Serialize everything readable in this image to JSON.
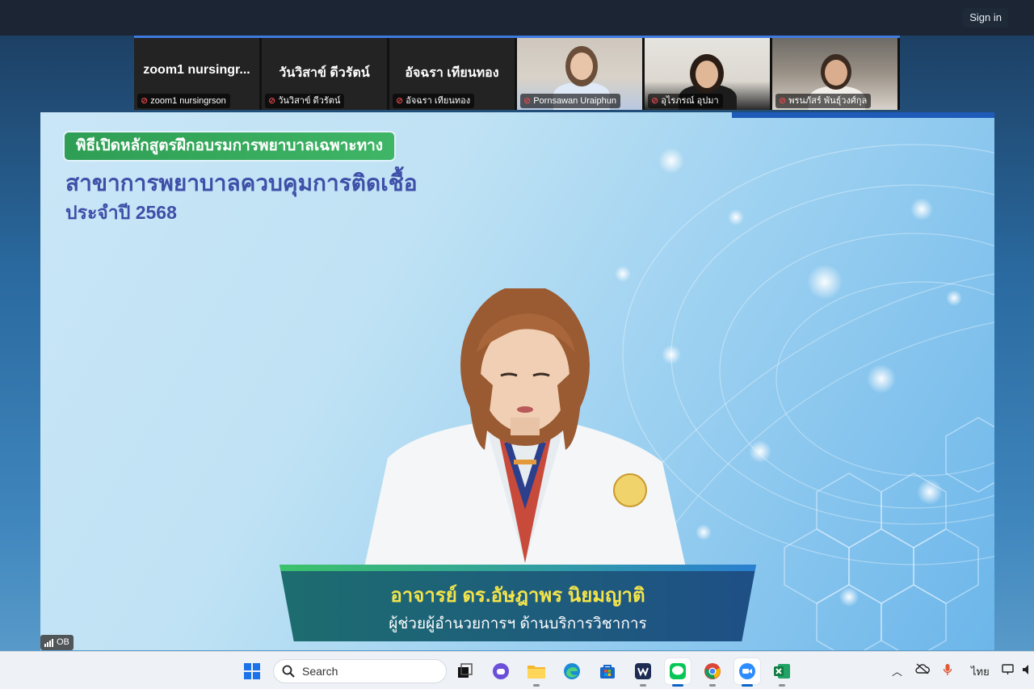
{
  "topbar": {
    "signin_label": "Sign in"
  },
  "participants": [
    {
      "display_name": "zoom1  nursingr...",
      "label": "zoom1 nursingrson",
      "video": false,
      "muted": true
    },
    {
      "display_name": "วันวิสาข์  ดีวรัตน์",
      "label": "วันวิสาข์  ดีวรัตน์",
      "video": false,
      "muted": true
    },
    {
      "display_name": "อัจฉรา  เทียนทอง",
      "label": "อัจฉรา เทียนทอง",
      "video": false,
      "muted": true
    },
    {
      "display_name": "",
      "label": "Pornsawan Uraiphun",
      "video": true,
      "muted": true
    },
    {
      "display_name": "",
      "label": "อุไรภรณ์ อุปมา",
      "video": true,
      "muted": true
    },
    {
      "display_name": "",
      "label": "พรนภัสร์ พันธุ์วงศ์กุล",
      "video": true,
      "muted": true
    }
  ],
  "slide": {
    "badge": "พิธีเปิดหลักสูตรฝึกอบรมการพยาบาลเฉพาะทาง",
    "title": "สาขาการพยาบาลควบคุมการติดเชื้อ",
    "year": "ประจำปี 2568",
    "speaker_name": "อาจารย์ ดร.อัษฎาพร นิยมญาติ",
    "speaker_role": "ผู้ช่วยผู้อำนวยการฯ ด้านบริการวิชาการ"
  },
  "connection": {
    "label": "OB"
  },
  "taskbar": {
    "search_label": "Search",
    "apps": [
      "windows-start",
      "task-view",
      "copilot",
      "file-explorer",
      "edge",
      "microsoft-store",
      "wacom",
      "line",
      "chrome",
      "zoom",
      "excel"
    ],
    "language": "ไทย"
  },
  "colors": {
    "accent_blue": "#3f7be0",
    "badge_green": "#2e9e54",
    "title_purple": "#3e4fa8",
    "caption_yellow": "#f4e44a",
    "mute_red": "#e5484d"
  }
}
